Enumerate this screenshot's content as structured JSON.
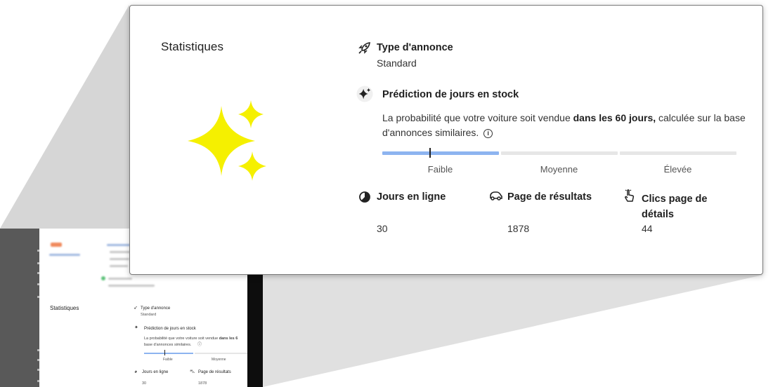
{
  "section_title": "Statistiques",
  "ad_type": {
    "label": "Type d'annonce",
    "value": "Standard",
    "icon": "rocket-icon"
  },
  "prediction": {
    "title": "Prédiction de jours en stock",
    "icon": "sparkle-icon",
    "text_before": "La probabilité que votre voiture soit vendue ",
    "text_bold": "dans les 60 jours,",
    "text_after": " calculée sur la base d'annonces similaires.",
    "info_icon": "info-icon",
    "levels": [
      "Faible",
      "Moyenne",
      "Élevée"
    ],
    "level_indicator": "Faible"
  },
  "stats": [
    {
      "label": "Jours en ligne",
      "value": "30",
      "icon": "pie-chart-icon"
    },
    {
      "label": "Page de résultats",
      "value": "1878",
      "icon": "car-icon"
    },
    {
      "label": "Clics page de détails",
      "value": "44",
      "icon": "pointer-hand-icon"
    }
  ],
  "colors": {
    "sparkle": "#f5f000",
    "bar_active": "#8db4f0",
    "bar_inactive": "#e6e6e6",
    "cone": "#d9d9d9"
  },
  "mini": {
    "section_title": "Statistiques",
    "ad_type_label": "Type d'annonce",
    "ad_type_value": "Standard",
    "prediction_title": "Prédiction de jours en stock",
    "desc_line1_before": "La probabilité que votre voiture soit vendue ",
    "desc_line1_bold": "dans les 6",
    "desc_line2": "base d'annonces similaires.",
    "level_low": "Faible",
    "level_mid": "Moyenne",
    "stat1_label": "Jours en ligne",
    "stat2_label": "Page de résultats",
    "stat1_value": "30",
    "stat2_value": "1878"
  }
}
